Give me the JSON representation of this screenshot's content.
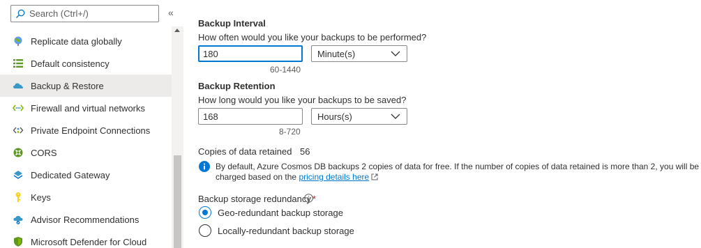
{
  "sidebar": {
    "search_placeholder": "Search (Ctrl+/)",
    "collapse_label": "«",
    "items": [
      {
        "label": "Replicate data globally",
        "icon": "globe-icon"
      },
      {
        "label": "Default consistency",
        "icon": "consistency-bars-icon"
      },
      {
        "label": "Backup & Restore",
        "icon": "cloud-backup-icon",
        "active": true
      },
      {
        "label": "Firewall and virtual networks",
        "icon": "firewall-network-icon"
      },
      {
        "label": "Private Endpoint Connections",
        "icon": "private-endpoint-icon"
      },
      {
        "label": "CORS",
        "icon": "cors-icon"
      },
      {
        "label": "Dedicated Gateway",
        "icon": "gateway-icon"
      },
      {
        "label": "Keys",
        "icon": "key-icon"
      },
      {
        "label": "Advisor Recommendations",
        "icon": "advisor-icon"
      },
      {
        "label": "Microsoft Defender for Cloud",
        "icon": "defender-shield-icon"
      }
    ]
  },
  "backup_interval": {
    "title": "Backup Interval",
    "question": "How often would you like your backups to be performed?",
    "value": "180",
    "unit": "Minute(s)",
    "range": "60-1440"
  },
  "backup_retention": {
    "title": "Backup Retention",
    "question": "How long would you like your backups to be saved?",
    "value": "168",
    "unit": "Hours(s)",
    "range": "8-720"
  },
  "copies": {
    "label": "Copies of data retained",
    "value": "56"
  },
  "info": {
    "text_before": "By default, Azure Cosmos DB backups 2 copies of data for free. If the number of copies of data retained is more than 2, you will be charged based on the ",
    "link": "pricing details here"
  },
  "redundancy": {
    "label": "Backup storage redundancy",
    "required": "*",
    "options": [
      {
        "label": "Geo-redundant backup storage",
        "checked": true
      },
      {
        "label": "Locally-redundant backup storage",
        "checked": false
      }
    ]
  },
  "colors": {
    "accent": "#0078d4",
    "active_bg": "#edebe9",
    "required": "#a4262c"
  }
}
